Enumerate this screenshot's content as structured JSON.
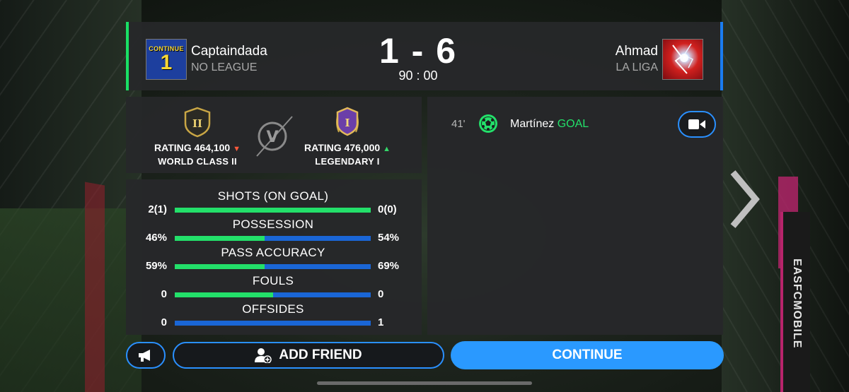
{
  "header": {
    "home": {
      "name": "Captaindada",
      "league": "NO LEAGUE",
      "badge_text": "CONTINUE",
      "badge_number": "1"
    },
    "away": {
      "name": "Ahmad",
      "league": "LA LIGA"
    },
    "score": "1 - 6",
    "time": "90 : 00"
  },
  "ratings": {
    "home": {
      "rating": "RATING 464,100",
      "tier": "WORLD CLASS II",
      "trend": "down",
      "badge_text": "II"
    },
    "away": {
      "rating": "RATING 476,000",
      "tier": "LEGENDARY I",
      "trend": "up",
      "badge_text": "I"
    },
    "vs_label": "V"
  },
  "stats": [
    {
      "label": "SHOTS (ON GOAL)",
      "home": "2(1)",
      "away": "0(0)",
      "home_share": 1.0
    },
    {
      "label": "POSSESSION",
      "home": "46%",
      "away": "54%",
      "home_share": 0.46
    },
    {
      "label": "PASS ACCURACY",
      "home": "59%",
      "away": "69%",
      "home_share": 0.46
    },
    {
      "label": "FOULS",
      "home": "0",
      "away": "0",
      "home_share": 0.5
    },
    {
      "label": "OFFSIDES",
      "home": "0",
      "away": "1",
      "home_share": 0.0
    }
  ],
  "events": [
    {
      "minute": "41'",
      "player": "Martínez",
      "type": "GOAL"
    }
  ],
  "buttons": {
    "add_friend": "ADD FRIEND",
    "continue": "CONTINUE"
  },
  "background": {
    "ad_text": "EASFCMOBILE"
  },
  "colors": {
    "home_accent": "#23e06a",
    "away_accent": "#1a66d6",
    "button_blue": "#2a99ff"
  }
}
